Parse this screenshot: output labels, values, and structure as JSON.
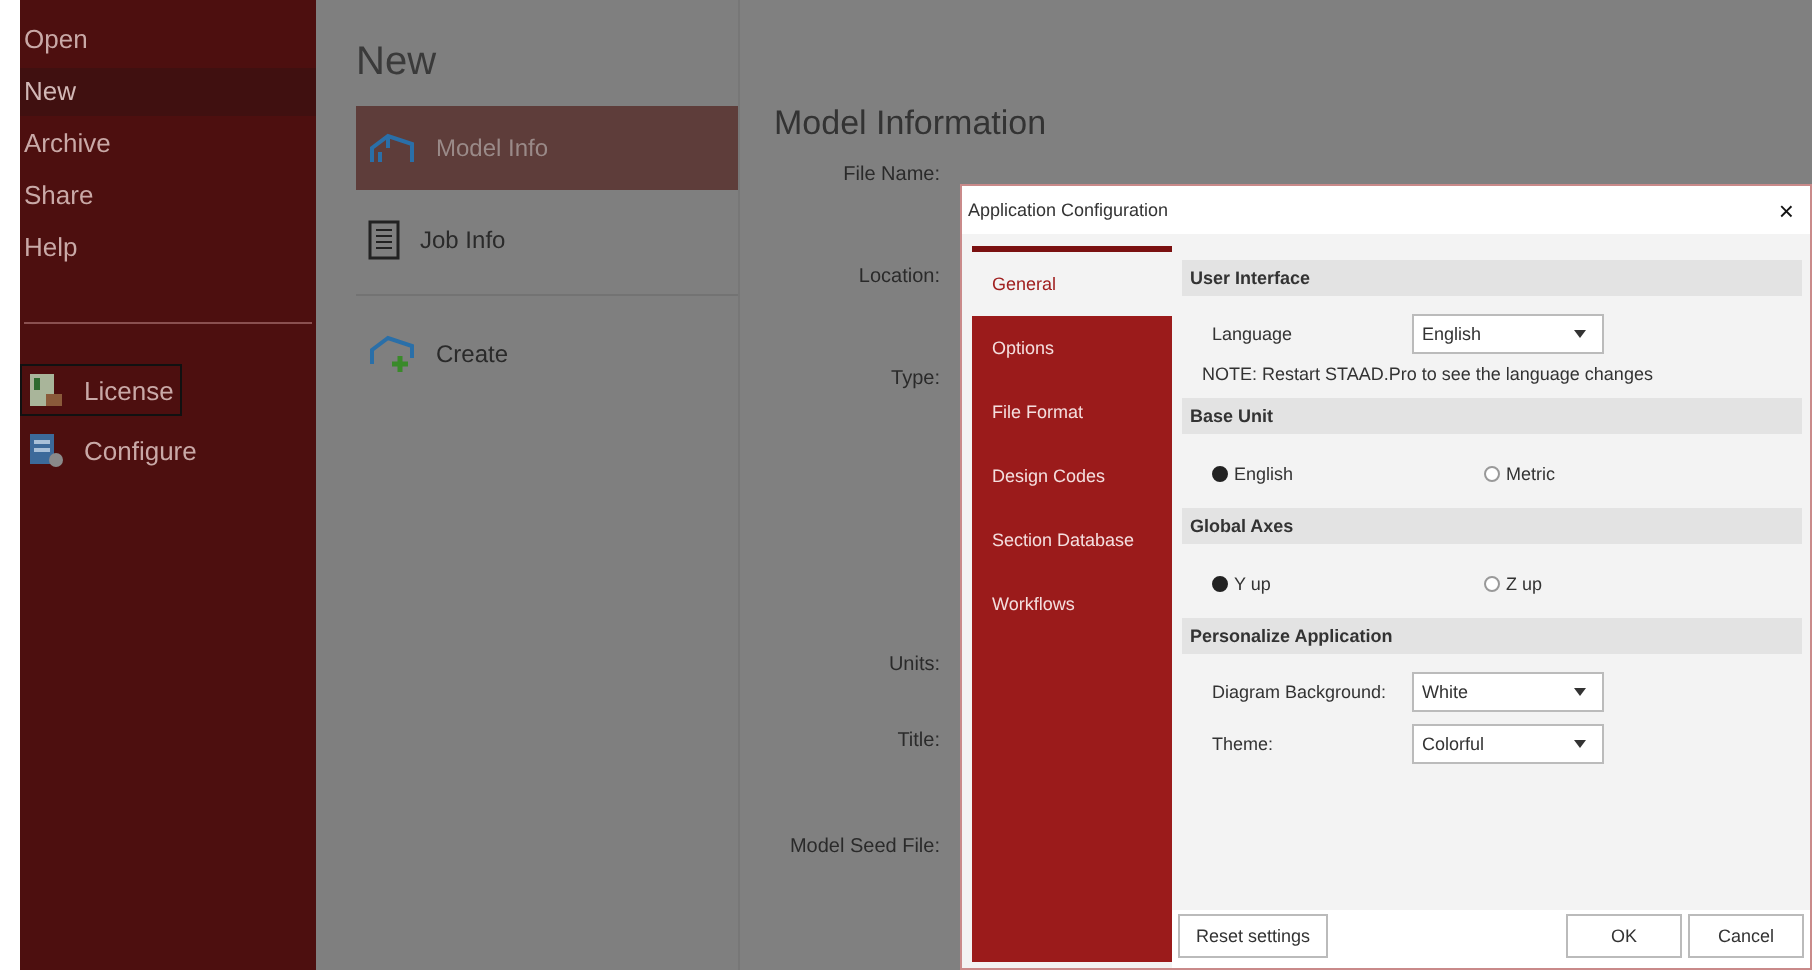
{
  "sidebar": {
    "items": [
      {
        "label": "Open",
        "selected": false,
        "outlined": false
      },
      {
        "label": "New",
        "selected": true,
        "outlined": false
      },
      {
        "label": "Archive",
        "selected": false,
        "outlined": false
      },
      {
        "label": "Share",
        "selected": false,
        "outlined": false
      },
      {
        "label": "Help",
        "selected": false,
        "outlined": false
      }
    ],
    "tools": [
      {
        "label": "License",
        "kind": "license",
        "outlined": true
      },
      {
        "label": "Configure",
        "kind": "configure",
        "outlined": false
      }
    ]
  },
  "new_panel": {
    "title": "New",
    "tiles": [
      {
        "label": "Model Info",
        "kind": "model",
        "selected": true
      },
      {
        "label": "Job Info",
        "kind": "job",
        "selected": false
      }
    ],
    "create": {
      "label": "Create"
    }
  },
  "model_information": {
    "title": "Model Information",
    "fields": [
      {
        "label": "File Name:"
      },
      {
        "label": "Location:"
      },
      {
        "label": "Type:"
      },
      {
        "label": "Units:"
      },
      {
        "label": "Title:"
      },
      {
        "label": "Model Seed File:"
      }
    ]
  },
  "dialog": {
    "title": "Application Configuration",
    "close": "×",
    "tabs": [
      {
        "label": "General",
        "selected": true
      },
      {
        "label": "Options",
        "selected": false
      },
      {
        "label": "File Format",
        "selected": false
      },
      {
        "label": "Design Codes",
        "selected": false
      },
      {
        "label": "Section Database",
        "selected": false
      },
      {
        "label": "Workflows",
        "selected": false
      }
    ],
    "sections": [
      {
        "title": "User Interface",
        "rows": [
          {
            "kind": "select",
            "label": "Language",
            "value": "English"
          },
          {
            "kind": "note",
            "text": "NOTE: Restart STAAD.Pro to see the language changes"
          }
        ]
      },
      {
        "title": "Base Unit",
        "rows": [
          {
            "kind": "radios",
            "options": [
              {
                "label": "English",
                "selected": true
              },
              {
                "label": "Metric",
                "selected": false
              }
            ]
          }
        ]
      },
      {
        "title": "Global Axes",
        "rows": [
          {
            "kind": "radios",
            "options": [
              {
                "label": "Y up",
                "selected": true
              },
              {
                "label": "Z up",
                "selected": false
              }
            ]
          }
        ]
      },
      {
        "title": "Personalize Application",
        "rows": [
          {
            "kind": "select",
            "label": "Diagram Background:",
            "value": "White"
          },
          {
            "kind": "select",
            "label": "Theme:",
            "value": "Colorful"
          }
        ]
      }
    ],
    "reset_button": "Reset settings",
    "buttons": [
      "OK",
      "Cancel"
    ]
  }
}
